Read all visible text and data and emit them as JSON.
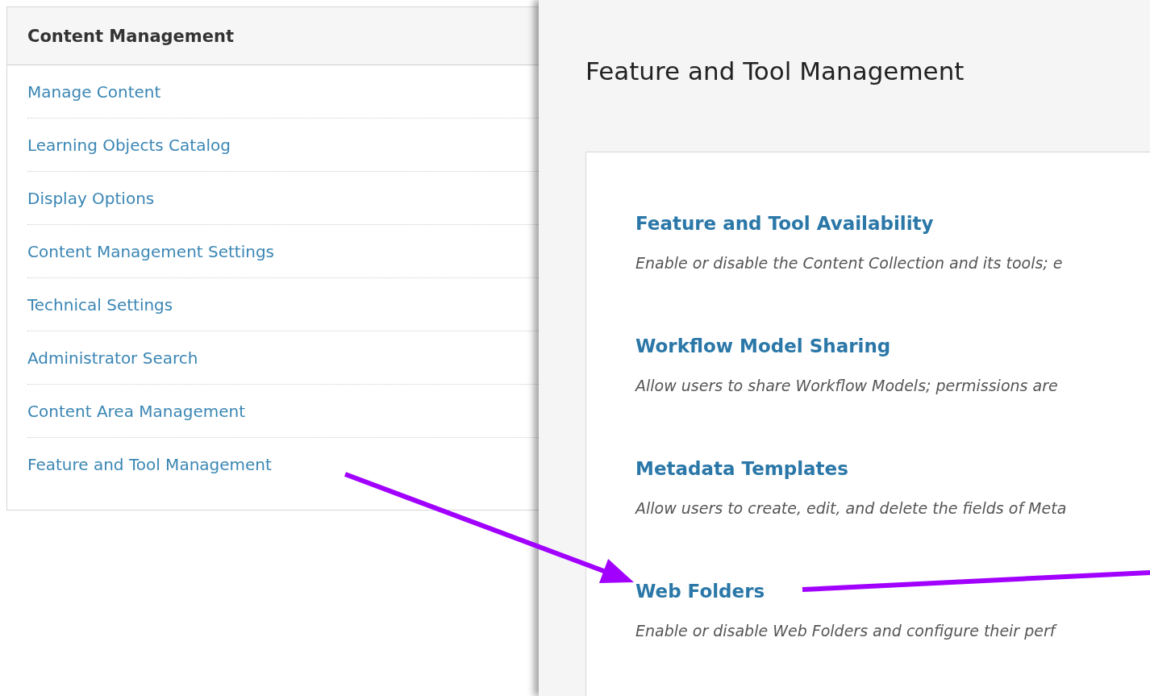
{
  "sidebar": {
    "title": "Content Management",
    "items": [
      {
        "label": "Manage Content"
      },
      {
        "label": "Learning Objects Catalog"
      },
      {
        "label": "Display Options"
      },
      {
        "label": "Content Management Settings"
      },
      {
        "label": "Technical Settings"
      },
      {
        "label": "Administrator Search"
      },
      {
        "label": "Content Area Management"
      },
      {
        "label": "Feature and Tool Management"
      }
    ]
  },
  "main": {
    "title": "Feature and Tool Management",
    "sections": [
      {
        "heading": "Feature and Tool Availability",
        "description": "Enable or disable the Content Collection and its tools; e"
      },
      {
        "heading": "Workflow Model Sharing",
        "description": "Allow users to share Workflow Models; permissions are"
      },
      {
        "heading": "Metadata Templates",
        "description": "Allow users to create, edit, and delete the fields of Meta"
      },
      {
        "heading": "Web Folders",
        "description": "Enable or disable Web Folders and configure their perf"
      }
    ]
  },
  "annotations": [
    {
      "kind": "arrow"
    },
    {
      "kind": "line"
    }
  ]
}
